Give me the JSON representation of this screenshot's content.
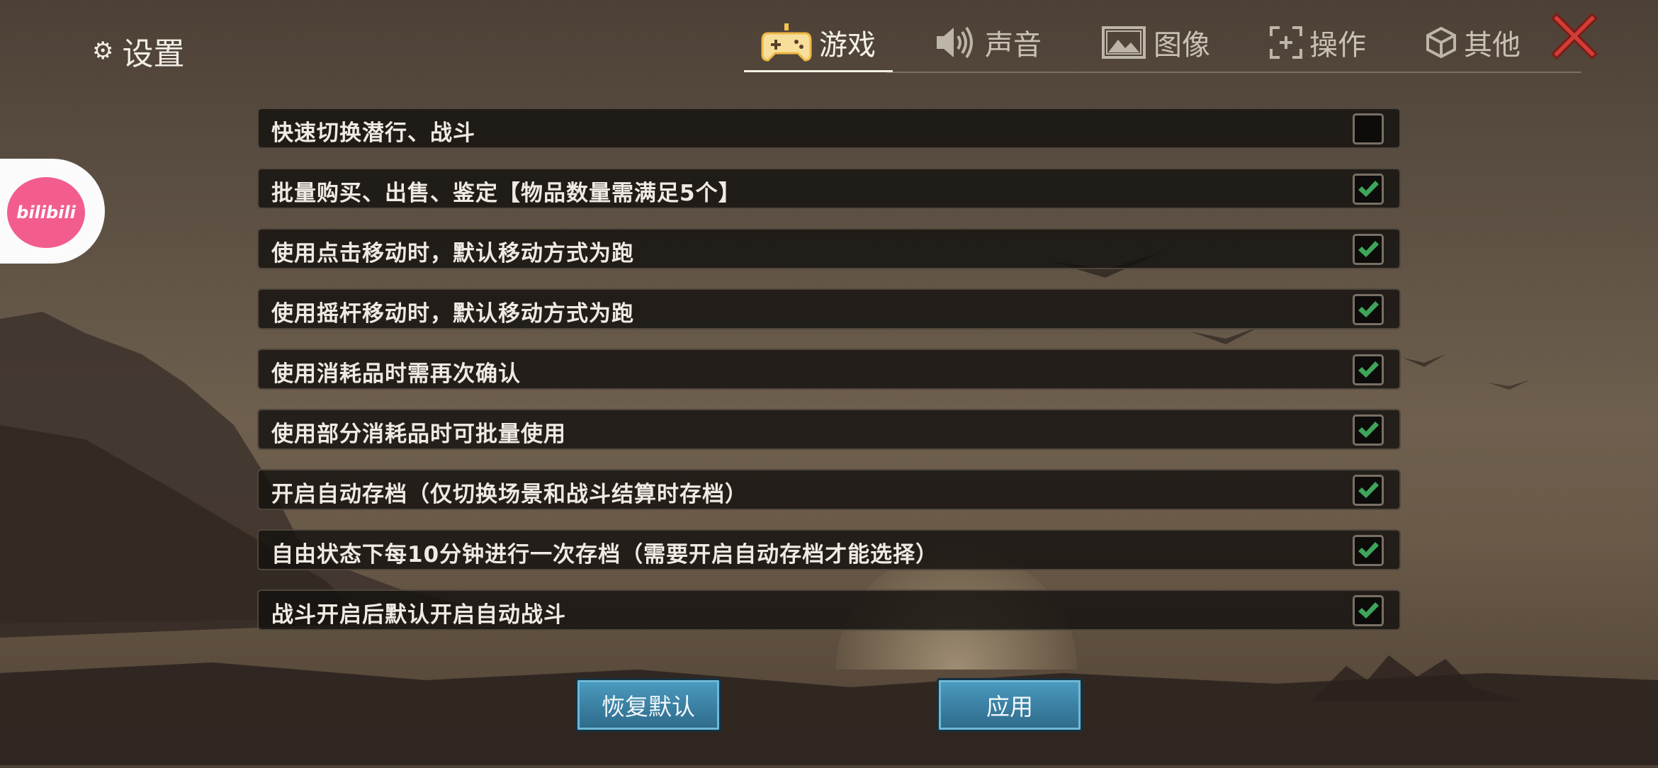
{
  "header": {
    "title": "设置",
    "gear_icon": "gear-icon"
  },
  "tabs": [
    {
      "label": "游戏",
      "icon": "gamepad-icon",
      "active": true
    },
    {
      "label": "声音",
      "icon": "speaker-icon",
      "active": false
    },
    {
      "label": "图像",
      "icon": "image-icon",
      "active": false
    },
    {
      "label": "操作",
      "icon": "target-icon",
      "active": false
    },
    {
      "label": "其他",
      "icon": "cube-icon",
      "active": false
    }
  ],
  "close_icon": "close-icon",
  "bilibili": {
    "text": "bilibili"
  },
  "options": [
    {
      "label": "快速切换潜行、战斗",
      "checked": false
    },
    {
      "label": "批量购买、出售、鉴定【物品数量需满足5个】",
      "checked": true
    },
    {
      "label": "使用点击移动时，默认移动方式为跑",
      "checked": true
    },
    {
      "label": "使用摇杆移动时，默认移动方式为跑",
      "checked": true
    },
    {
      "label": "使用消耗品时需再次确认",
      "checked": true
    },
    {
      "label": "使用部分消耗品时可批量使用",
      "checked": true
    },
    {
      "label": "开启自动存档（仅切换场景和战斗结算时存档）",
      "checked": true
    },
    {
      "label": "自由状态下每10分钟进行一次存档（需要开启自动存档才能选择）",
      "checked": true
    },
    {
      "label": "战斗开启后默认开启自动战斗",
      "checked": true
    }
  ],
  "buttons": {
    "reset_label": "恢复默认",
    "apply_label": "应用"
  },
  "colors": {
    "check_green": "#3fa55a",
    "close_red": "#c8352f",
    "button_blue": "#3a7fa2"
  }
}
